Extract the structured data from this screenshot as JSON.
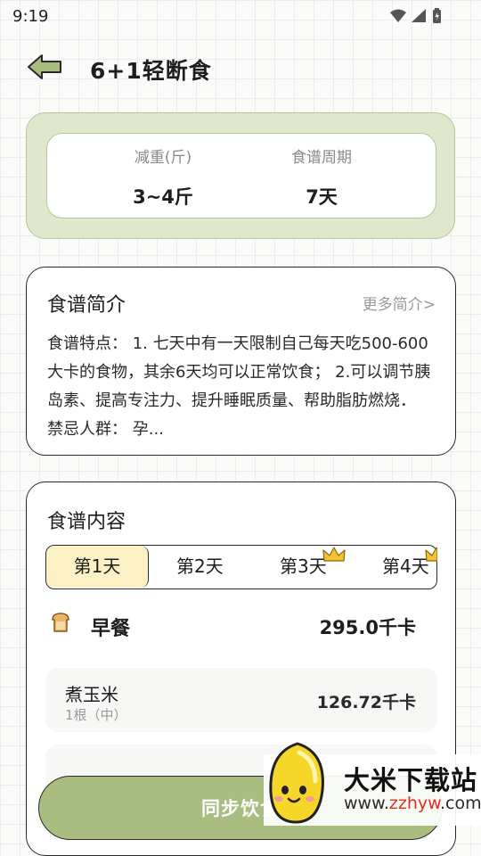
{
  "status_bar": {
    "time": "9:19",
    "icons": [
      "wifi-icon",
      "signal-icon",
      "battery-icon"
    ]
  },
  "header": {
    "title": "6+1轻断食",
    "back_icon": "back-arrow-icon"
  },
  "summary": {
    "weight_loss_label": "减重(斤)",
    "weight_loss_value": "3~4斤",
    "cycle_label": "食谱周期",
    "cycle_value": "7天"
  },
  "intro": {
    "title": "食谱简介",
    "more_link": "更多简介>",
    "text": "食谱特点： 1. 七天中有一天限制自己每天吃500-600大卡的食物，其余6天均可以正常饮食； 2.可以调节胰岛素、提高专注力、提升睡眠质量、帮助脂肪燃烧． 禁忌人群： 孕..."
  },
  "content": {
    "title": "食谱内容",
    "tabs": [
      {
        "label": "第1天",
        "active": true,
        "premium": false
      },
      {
        "label": "第2天",
        "active": false,
        "premium": false
      },
      {
        "label": "第3天",
        "active": false,
        "premium": true
      },
      {
        "label": "第4天",
        "active": false,
        "premium": true
      }
    ],
    "meal": {
      "icon": "bread-icon",
      "name": "早餐",
      "calories": "295.0千卡"
    },
    "foods": [
      {
        "name": "煮玉米",
        "amount": "1根（中）",
        "calories": "126.72千卡"
      }
    ]
  },
  "actions": {
    "sync_label": "同步饮食"
  },
  "watermark": {
    "name": "大米下载站",
    "url_prefix": "www.",
    "url_brand": "zzhyw",
    "url_suffix": ".com"
  },
  "colors": {
    "accent_green": "#a9bd81",
    "summary_bg": "#dfe8cc",
    "active_tab": "#fbf1c4",
    "crown": "#f2c233"
  }
}
